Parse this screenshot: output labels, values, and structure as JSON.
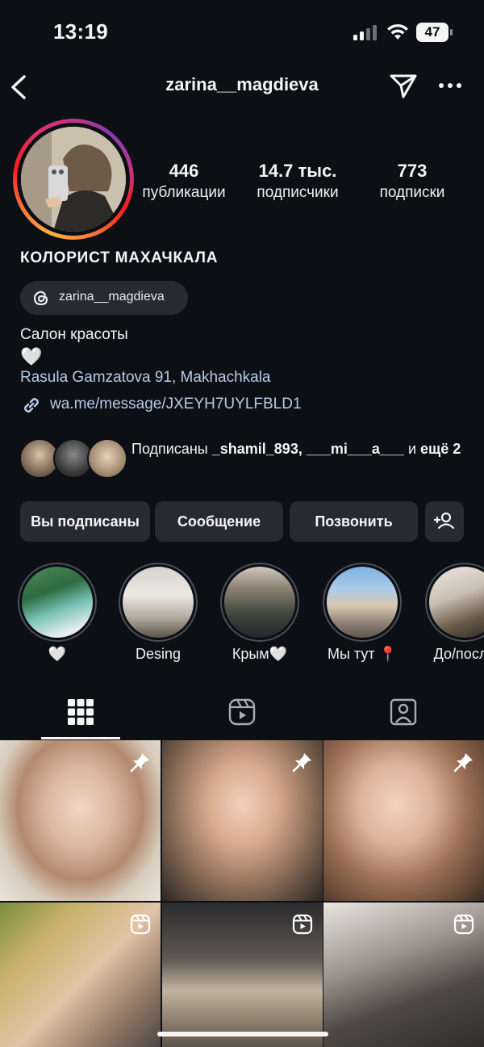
{
  "status_bar": {
    "time": "13:19",
    "battery": "47"
  },
  "nav": {
    "username": "zarina__magdieva"
  },
  "stats": [
    {
      "value": "446",
      "label": "публикации"
    },
    {
      "value": "14.7 тыс.",
      "label": "подписчики"
    },
    {
      "value": "773",
      "label": "подписки"
    }
  ],
  "profile": {
    "name": "КОЛОРИСТ  МАХАЧКАЛА",
    "threads_handle": "zarina__magdieva",
    "category": "Салон красоты",
    "bio_emoji": "🤍",
    "address": "Rasula Gamzatova 91, Makhachkala",
    "link": "wa.me/message/JXEYH7UYLFBLD1"
  },
  "followed_by": {
    "prefix": "Подписаны ",
    "names": "_shamil_893, ___mi___a___",
    "joiner": " и ",
    "more": "ещё 2"
  },
  "buttons": {
    "following": "Вы подписаны",
    "message": "Сообщение",
    "call": "Позвонить",
    "add_person_icon": "add-person-icon"
  },
  "highlights": [
    {
      "label": "🤍"
    },
    {
      "label": "Desing"
    },
    {
      "label": "Крым🤍"
    },
    {
      "label": "Мы тут 📍"
    },
    {
      "label": "До/после"
    }
  ],
  "tabs": [
    "grid-icon",
    "reels-icon",
    "tagged-icon"
  ],
  "posts": [
    {
      "badge": "pin-icon"
    },
    {
      "badge": "pin-icon"
    },
    {
      "badge": "pin-icon"
    },
    {
      "badge": "reel-icon"
    },
    {
      "badge": "reel-icon"
    },
    {
      "badge": "reel-icon"
    }
  ],
  "colors": {
    "background": "#0c0f14",
    "button": "#262a31",
    "link": "#b6cce8"
  }
}
